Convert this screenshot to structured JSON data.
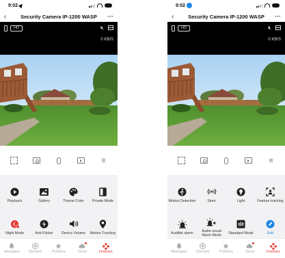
{
  "phones": [
    {
      "status": {
        "time": "9:02"
      },
      "nav": {
        "title": "Security Camera IP-1200 WASP"
      },
      "video": {
        "quality": "HD",
        "speed": "0 KB/S"
      },
      "features": [
        {
          "icon": "playback-icon",
          "label": "Playback"
        },
        {
          "icon": "gallery-icon",
          "label": "Gallery"
        },
        {
          "icon": "palette-icon",
          "label": "Theme Color"
        },
        {
          "icon": "private-mode-icon",
          "label": "Private Mode"
        },
        {
          "icon": "night-mode-icon",
          "label": "Night Mode"
        },
        {
          "icon": "anti-flicker-icon",
          "label": "Anti-Flicker"
        },
        {
          "icon": "speaker-icon",
          "label": "Device Volume"
        },
        {
          "icon": "location-pin-icon",
          "label": "Motion Tracking"
        }
      ]
    },
    {
      "status": {
        "time": "9:02"
      },
      "nav": {
        "title": "Security Camera IP-1200 WASP"
      },
      "video": {
        "quality": "HD",
        "speed": "0 KB/S"
      },
      "features": [
        {
          "icon": "motion-detection-icon",
          "label": "Motion Detection"
        },
        {
          "icon": "siren-icon",
          "label": "Siren"
        },
        {
          "icon": "light-icon",
          "label": "Light"
        },
        {
          "icon": "feature-tracking-icon",
          "label": "Feature tracking"
        },
        {
          "icon": "alarm-icon",
          "label": "Audible alarm"
        },
        {
          "icon": "audio-visual-icon",
          "label": "Audio-visual Alarm Mode"
        },
        {
          "icon": "standard-mode-icon",
          "label": "Standard Mode"
        },
        {
          "icon": "edit-icon",
          "label": "Edit"
        }
      ]
    }
  ],
  "tabs": [
    {
      "icon": "bell-icon",
      "label": "Messages"
    },
    {
      "icon": "direction-icon",
      "label": "Direction"
    },
    {
      "icon": "star-icon",
      "label": "Positions"
    },
    {
      "icon": "cloud-icon",
      "label": "Cloud"
    },
    {
      "icon": "features-icon",
      "label": "Features"
    }
  ],
  "colors": {
    "accent_red": "#e53935",
    "accent_blue": "#1e88e5",
    "panel_bg": "#f2f2f4"
  }
}
